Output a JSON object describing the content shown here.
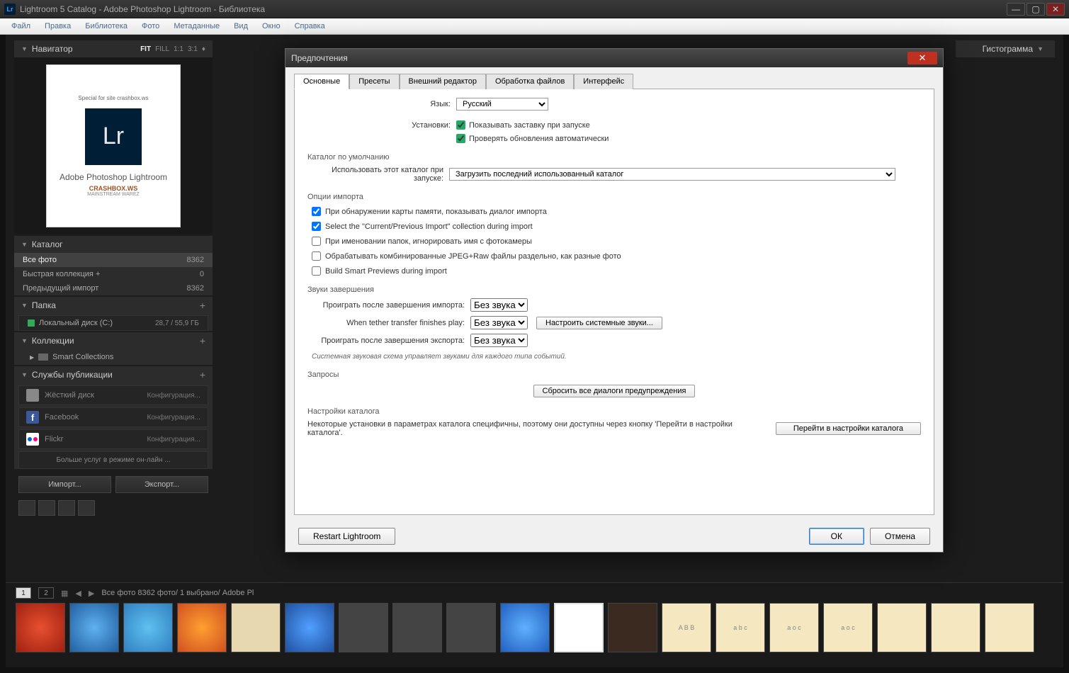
{
  "window": {
    "title": "Lightroom 5 Catalog - Adobe Photoshop Lightroom - Библиотека",
    "lr_badge": "Lr"
  },
  "menubar": [
    "Файл",
    "Правка",
    "Библиотека",
    "Фото",
    "Метаданные",
    "Вид",
    "Окно",
    "Справка"
  ],
  "navigator": {
    "title": "Навигатор",
    "zoom": [
      "FIT",
      "FILL",
      "1:1",
      "3:1"
    ],
    "boxart_small": "Special for site crashbox.ws",
    "boxart_caption": "Adobe Photoshop\nLightroom",
    "boxart_crashbox": "CRASHBOX.WS",
    "boxart_sub": "MAINSTREAM WAREZ"
  },
  "catalog": {
    "title": "Каталог",
    "rows": [
      {
        "name": "Все фото",
        "count": "8362"
      },
      {
        "name": "Быстрая коллекция +",
        "count": "0"
      },
      {
        "name": "Предыдущий импорт",
        "count": "8362"
      }
    ]
  },
  "folders": {
    "title": "Папка",
    "drive": "Локальный диск (C:)",
    "size": "28,7 / 55,9 ГБ"
  },
  "collections": {
    "title": "Коллекции",
    "smart": "Smart Collections"
  },
  "publish": {
    "title": "Службы публикации",
    "services": [
      {
        "name": "Жёсткий диск",
        "config": "Конфигурация..."
      },
      {
        "name": "Facebook",
        "config": "Конфигурация..."
      },
      {
        "name": "Flickr",
        "config": "Конфигурация..."
      }
    ],
    "more": "Больше услуг в режиме он-лайн ..."
  },
  "buttons": {
    "import": "Импорт...",
    "export": "Экспорт..."
  },
  "right": {
    "histogram": "Гистограмма"
  },
  "filmstrip": {
    "pages": [
      "1",
      "2"
    ],
    "info": "Все фото  8362 фото/  1 выбрано/  Adobe Pl"
  },
  "modal": {
    "title": "Предпочтения",
    "tabs": [
      "Основные",
      "Пресеты",
      "Внешний редактор",
      "Обработка файлов",
      "Интерфейс"
    ],
    "lang_label": "Язык:",
    "lang_value": "Русский",
    "settings_label": "Установки:",
    "show_splash": "Показывать заставку при запуске",
    "auto_update": "Проверять обновления автоматически",
    "default_catalog_title": "Каталог по умолчанию",
    "use_catalog_label": "Использовать этот каталог при запуске:",
    "use_catalog_value": "Загрузить последний использованный каталог",
    "import_title": "Опции импорта",
    "import_opts": [
      {
        "checked": true,
        "label": "При обнаружении карты памяти, показывать диалог импорта"
      },
      {
        "checked": true,
        "label": "Select the \"Current/Previous Import\" collection during import"
      },
      {
        "checked": false,
        "label": "При именовании папок, игнорировать имя с фотокамеры"
      },
      {
        "checked": false,
        "label": "Обрабатывать комбинированные JPEG+Raw файлы раздельно, как разные фото"
      },
      {
        "checked": false,
        "label": "Build Smart Previews during import"
      }
    ],
    "sounds_title": "Звуки завершения",
    "sound_rows": [
      {
        "label": "Проиграть после завершения импорта:",
        "value": "Без звука"
      },
      {
        "label": "When tether transfer finishes play:",
        "value": "Без звука"
      },
      {
        "label": "Проиграть после завершения экспорта:",
        "value": "Без звука"
      }
    ],
    "sys_sounds_btn": "Настроить системные звуки...",
    "sound_note": "Системная звуковая схема управляет звуками для каждого типа событий.",
    "prompts_title": "Запросы",
    "reset_prompts_btn": "Сбросить все диалоги предупреждения",
    "catalog_settings_title": "Настройки каталога",
    "catalog_note": "Некоторые установки в параметрах каталога специфичны, поэтому они доступны через кнопку 'Перейти в настройки каталога'.",
    "goto_catalog_btn": "Перейти в настройки каталога",
    "restart_btn": "Restart Lightroom",
    "ok_btn": "ОК",
    "cancel_btn": "Отмена"
  }
}
